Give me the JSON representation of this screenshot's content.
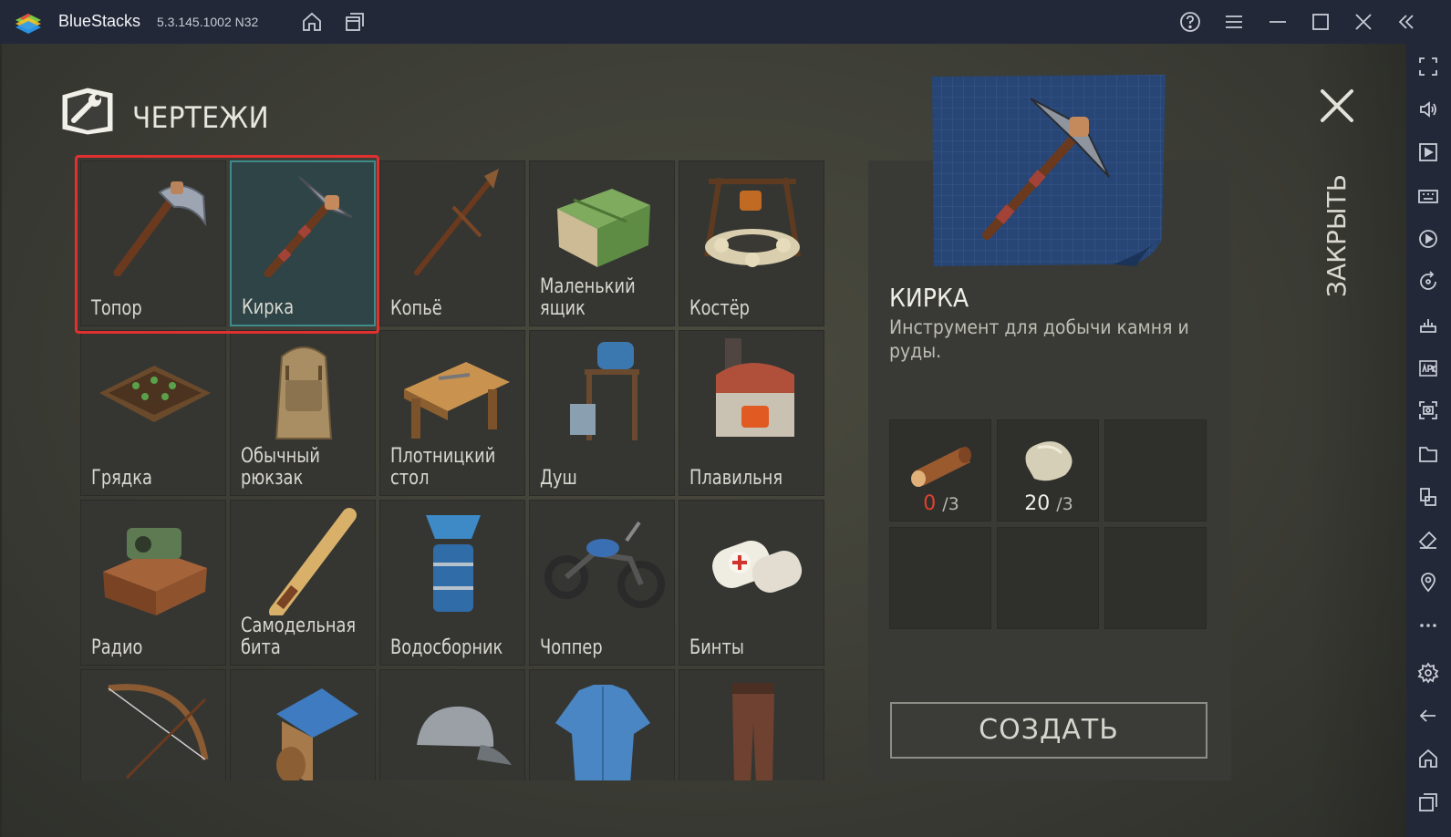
{
  "window": {
    "app_name": "BlueStacks",
    "version": "5.3.145.1002 N32",
    "icons": [
      "home-icon",
      "multi-instance-icon",
      "help-icon",
      "menu-icon",
      "minimize-icon",
      "maximize-icon",
      "close-icon",
      "collapse-sidebar-icon"
    ]
  },
  "sidebar": {
    "icons": [
      "fullscreen-icon",
      "volume-icon",
      "media-play-icon",
      "keyboard-icon",
      "macro-icon",
      "rotate-icon",
      "controls-icon",
      "apk-icon",
      "screenshot-icon",
      "folder-icon",
      "multi-instance-sync-icon",
      "eraser-icon",
      "location-icon",
      "more-icon",
      "settings-icon",
      "back-icon",
      "android-home-icon",
      "recents-icon"
    ]
  },
  "blueprints": {
    "title": "ЧЕРТЕЖИ",
    "items": [
      {
        "label": "Топор",
        "icon": "axe-icon"
      },
      {
        "label": "Кирка",
        "icon": "pickaxe-icon",
        "selected": true
      },
      {
        "label": "Копьё",
        "icon": "spear-icon"
      },
      {
        "label": "Маленький ящик",
        "icon": "small-box-icon"
      },
      {
        "label": "Костёр",
        "icon": "campfire-icon"
      },
      {
        "label": "Грядка",
        "icon": "garden-bed-icon"
      },
      {
        "label": "Обычный рюкзак",
        "icon": "backpack-icon"
      },
      {
        "label": "Плотницкий стол",
        "icon": "carpentry-table-icon"
      },
      {
        "label": "Душ",
        "icon": "shower-icon"
      },
      {
        "label": "Плавильня",
        "icon": "smelter-icon"
      },
      {
        "label": "Радио",
        "icon": "radio-icon"
      },
      {
        "label": "Самодельная бита",
        "icon": "homemade-bat-icon"
      },
      {
        "label": "Водосборник",
        "icon": "water-collector-icon"
      },
      {
        "label": "Чоппер",
        "icon": "chopper-icon"
      },
      {
        "label": "Бинты",
        "icon": "bandages-icon"
      },
      {
        "label": "",
        "icon": "bow-icon"
      },
      {
        "label": "",
        "icon": "doghouse-icon"
      },
      {
        "label": "",
        "icon": "cap-icon"
      },
      {
        "label": "",
        "icon": "shirt-icon"
      },
      {
        "label": "",
        "icon": "pants-icon"
      }
    ]
  },
  "detail": {
    "title": "КИРКА",
    "description": "Инструмент для добычи камня и руды.",
    "resources": [
      {
        "icon": "wood-log-icon",
        "have": "0",
        "need": "/3",
        "have_color": "#e0402e"
      },
      {
        "icon": "stone-icon",
        "have": "20",
        "need": "/3",
        "have_color": "#f0efe8"
      }
    ],
    "create_label": "СОЗДАТЬ",
    "close_label": "ЗАКРЫТЬ"
  }
}
